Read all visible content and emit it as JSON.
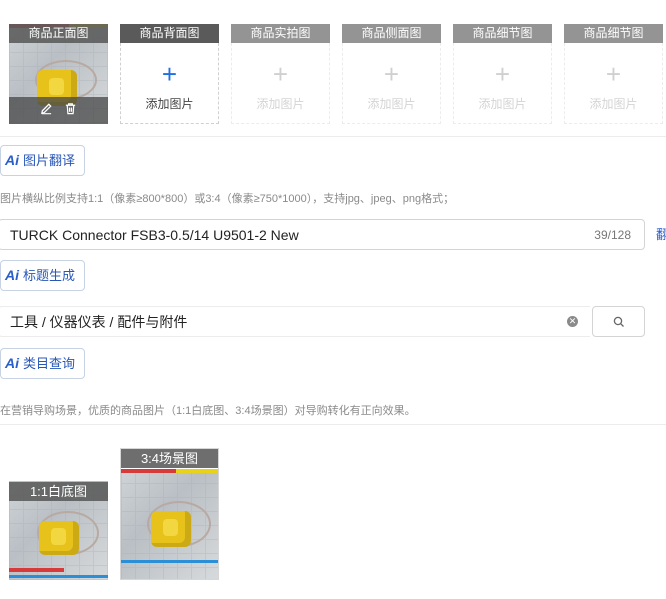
{
  "image_slots": [
    {
      "caption": "商品正面图",
      "state": "filled"
    },
    {
      "caption": "商品背面图",
      "state": "active",
      "add_label": "添加图片"
    },
    {
      "caption": "商品实拍图",
      "state": "empty",
      "add_label": "添加图片"
    },
    {
      "caption": "商品侧面图",
      "state": "empty",
      "add_label": "添加图片"
    },
    {
      "caption": "商品细节图",
      "state": "empty",
      "add_label": "添加图片"
    },
    {
      "caption": "商品细节图",
      "state": "empty",
      "add_label": "添加图片"
    }
  ],
  "image_translate": {
    "ai": "Ai",
    "label": "图片翻译"
  },
  "image_hint": "图片横纵比例支持1:1（像素≥800*800）或3:4（像素≥750*1000），支持jpg、jpeg、png格式；",
  "title_input": {
    "value": "TURCK Connector FSB3-0.5/14 U9501-2 New",
    "count": "39/128",
    "side_link": "翻"
  },
  "title_generate": {
    "ai": "Ai",
    "label": "标题生成"
  },
  "category_input": {
    "value": "工具 / 仪器仪表 / 配件与附件"
  },
  "category_query": {
    "ai": "Ai",
    "label": "类目查询"
  },
  "marketing_hint": "在营销导购场景，优质的商品图片（1:1白底图、3:4场景图）对导购转化有正向效果。",
  "marketing_images": [
    {
      "caption": "1:1白底图"
    },
    {
      "caption": "3:4场景图"
    }
  ],
  "colors": {
    "accent": "#1e6fe0",
    "ai_blue": "#2a5ec9",
    "caption_bg": "#6e6e6e"
  }
}
